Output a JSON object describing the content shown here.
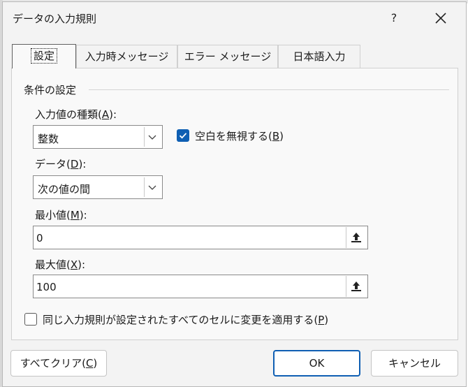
{
  "dialog": {
    "title": "データの入力規則",
    "help_label": "?"
  },
  "tabs": [
    {
      "label": "設定",
      "active": true
    },
    {
      "label": "入力時メッセージ",
      "active": false
    },
    {
      "label": "エラー メッセージ",
      "active": false
    },
    {
      "label": "日本語入力",
      "active": false
    }
  ],
  "settings": {
    "group_title": "条件の設定",
    "allow_label": "入力値の種類",
    "allow_accel": "A",
    "allow_value": "整数",
    "ignore_blank_label": "空白を無視する",
    "ignore_blank_accel": "B",
    "ignore_blank_checked": true,
    "data_label": "データ",
    "data_accel": "D",
    "data_value": "次の値の間",
    "min_label": "最小値",
    "min_accel": "M",
    "min_value": "0",
    "max_label": "最大値",
    "max_accel": "X",
    "max_value": "100",
    "apply_all_label": "同じ入力規則が設定されたすべてのセルに変更を適用する",
    "apply_all_accel": "P",
    "apply_all_checked": false
  },
  "buttons": {
    "clear_all_label": "すべてクリア",
    "clear_all_accel": "C",
    "ok_label": "OK",
    "cancel_label": "キャンセル"
  },
  "colors": {
    "accent": "#0f5fb3",
    "dialog_bg": "#f3f3f3",
    "panel_bg": "#f9f9f9"
  }
}
